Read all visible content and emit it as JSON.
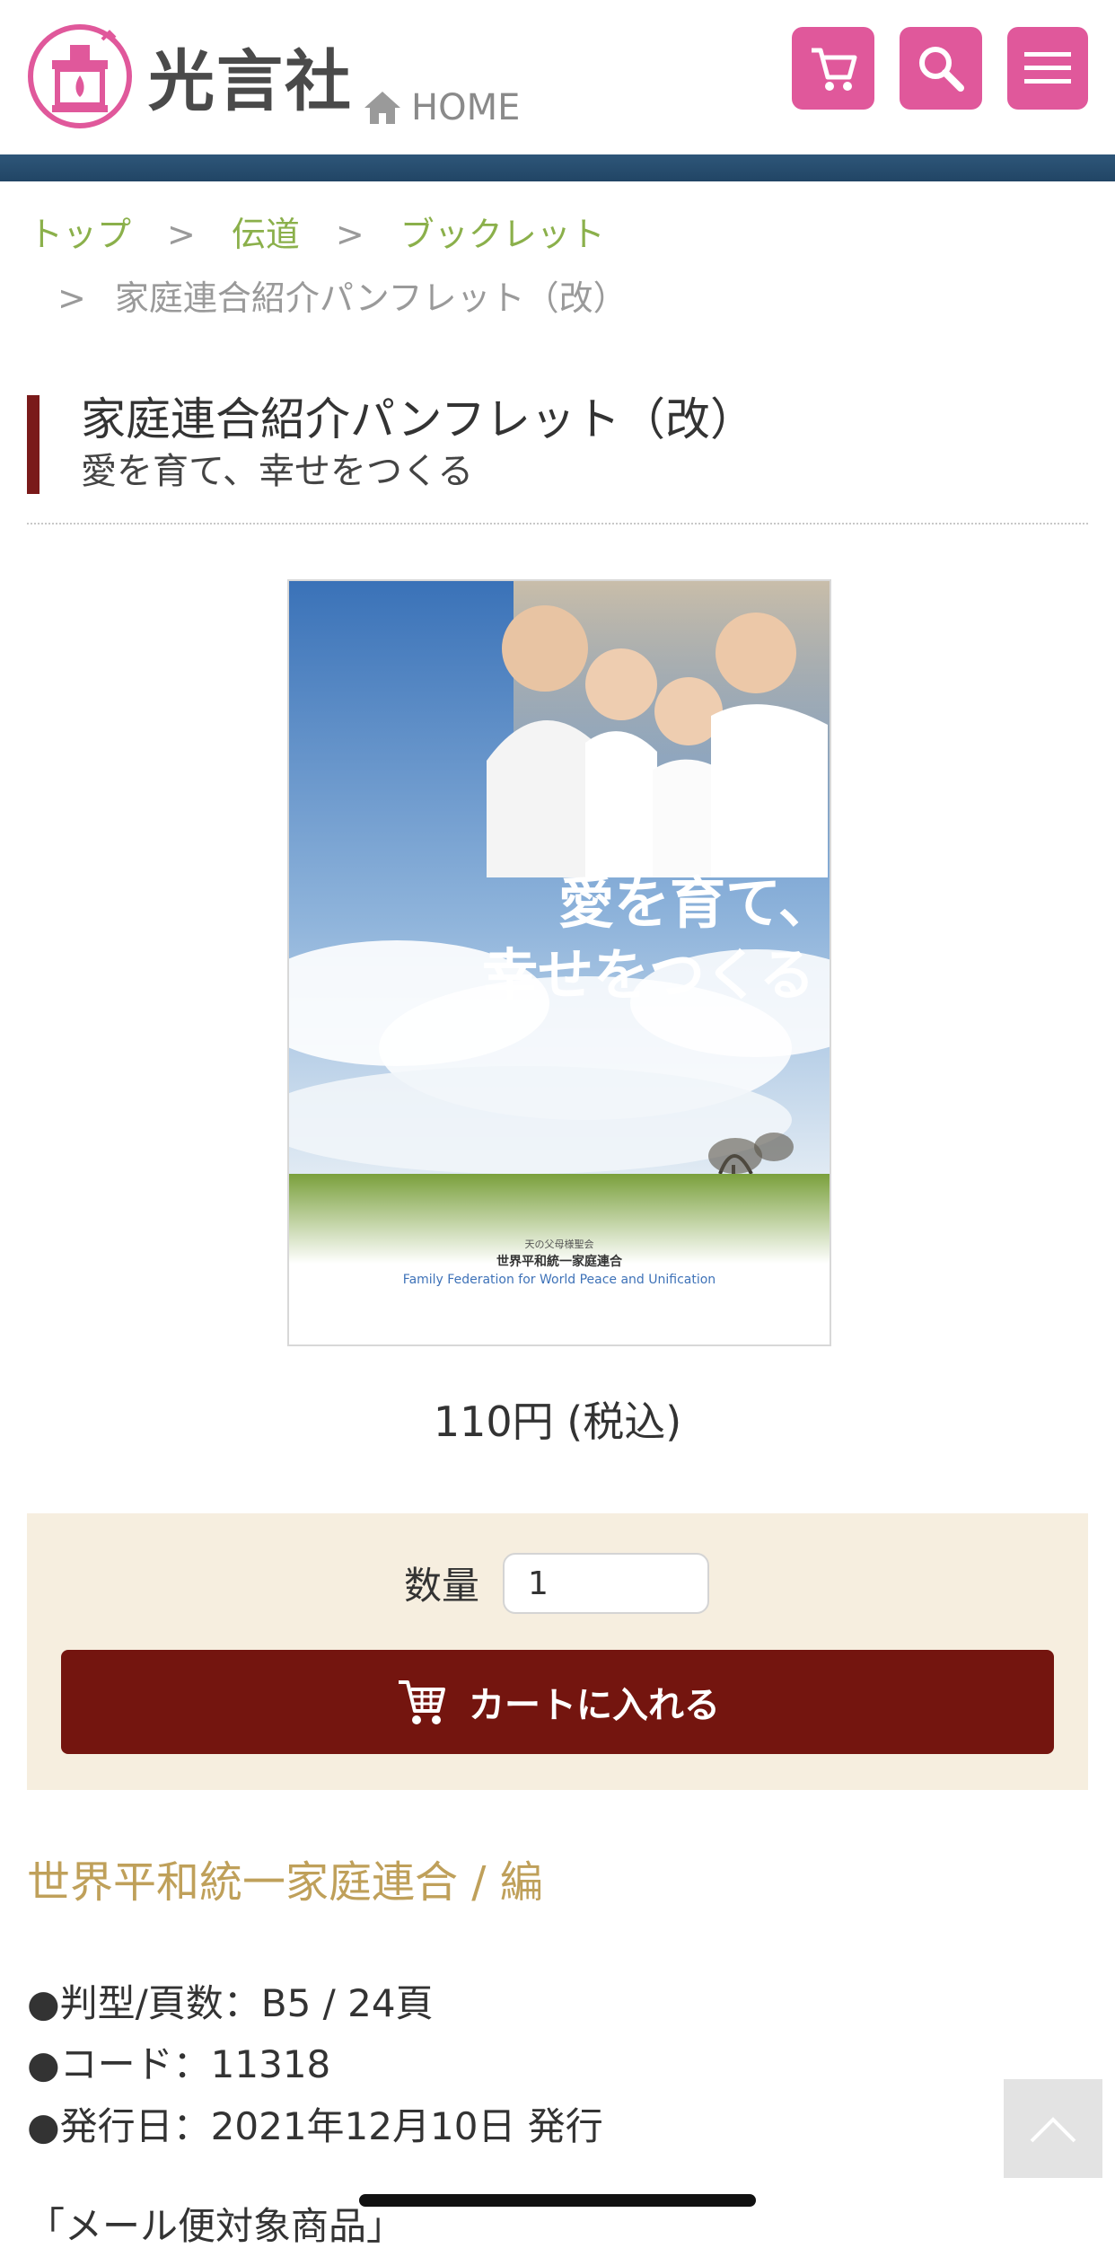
{
  "header": {
    "logo_text": "光言社",
    "home_label": "HOME",
    "icons": [
      "cart-icon",
      "search-icon",
      "menu-icon"
    ],
    "accent_color": "#e0589b",
    "bar_color": "#2e5679"
  },
  "breadcrumb": {
    "items": [
      "トップ",
      "伝道",
      "ブックレット"
    ],
    "separator": ">",
    "current": "家庭連合紹介パンフレット（改）"
  },
  "product": {
    "title": "家庭連合紹介パンフレット（改）",
    "subtitle": "愛を育て、幸せをつくる",
    "cover": {
      "headline_line1": "愛を育て、",
      "headline_line2": "幸せをつくる",
      "org_small": "天の父母様聖会",
      "org_jp": "世界平和統一家庭連合",
      "org_en": "Family Federation for World Peace and Unification"
    },
    "price": "110円 (税込)",
    "quantity_label": "数量",
    "quantity_value": "1",
    "add_to_cart_label": "カートに入れる",
    "editor": "世界平和統一家庭連合 / 編",
    "specs": [
      "●判型/頁数：B5 / 24頁",
      "●コード：11318",
      "●発行日：2021年12月10日 発行"
    ],
    "cut_off_text": "「メール便対象商品」"
  }
}
